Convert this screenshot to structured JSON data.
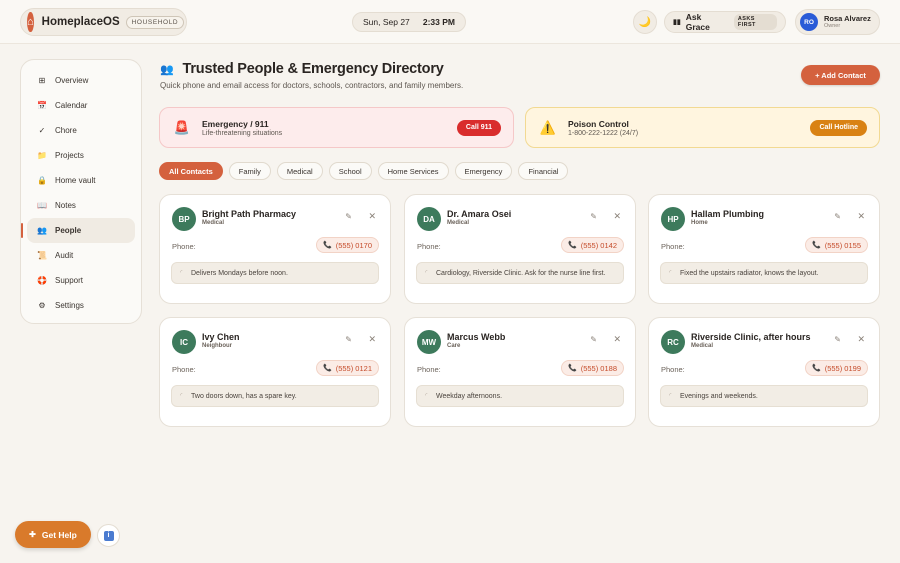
{
  "app": {
    "name": "HomeplaceOS",
    "household_tag": "HOUSEHOLD"
  },
  "topbar": {
    "date": "Sun, Sep 27",
    "time": "2:33 PM",
    "theme_icon": "moon-icon",
    "ask_label": "Ask Grace",
    "ask_tag": "ASKS FIRST",
    "user": {
      "initials": "RO",
      "name": "Rosa Alvarez",
      "role": "Owner"
    }
  },
  "sidebar": {
    "items": [
      {
        "label": "Overview",
        "icon": "grid-icon"
      },
      {
        "label": "Calendar",
        "icon": "calendar-icon"
      },
      {
        "label": "Chore",
        "icon": "check-icon"
      },
      {
        "label": "Projects",
        "icon": "folder-icon"
      },
      {
        "label": "Home vault",
        "icon": "lock-icon"
      },
      {
        "label": "Notes",
        "icon": "book-icon"
      },
      {
        "label": "People",
        "icon": "people-icon",
        "active": true
      },
      {
        "label": "Audit",
        "icon": "scroll-icon"
      },
      {
        "label": "Support",
        "icon": "lifebuoy-icon"
      },
      {
        "label": "Settings",
        "icon": "gear-icon"
      }
    ]
  },
  "header": {
    "title": "Trusted People & Emergency Directory",
    "subtitle": "Quick phone and email access for doctors, schools, contractors, and family members.",
    "add_label": "+ Add Contact"
  },
  "alerts": [
    {
      "title": "Emergency / 911",
      "subtitle": "Life-threatening situations",
      "button": "Call 911",
      "color": "#d92d2d"
    },
    {
      "title": "Poison Control",
      "subtitle": "1-800-222-1222 (24/7)",
      "button": "Call Hotline",
      "color": "#d98214"
    }
  ],
  "filters": [
    "All Contacts",
    "Family",
    "Medical",
    "School",
    "Home Services",
    "Emergency",
    "Financial"
  ],
  "active_filter": "All Contacts",
  "phone_label": "Phone:",
  "contacts": [
    {
      "initials": "BP",
      "name": "Bright Path Pharmacy",
      "role": "Medical",
      "phone": "(555) 0170",
      "note": "Delivers Mondays before noon."
    },
    {
      "initials": "DA",
      "name": "Dr. Amara Osei",
      "role": "Medical",
      "phone": "(555) 0142",
      "note": "Cardiology, Riverside Clinic. Ask for the nurse line first."
    },
    {
      "initials": "HP",
      "name": "Hallam Plumbing",
      "role": "Home",
      "phone": "(555) 0155",
      "note": "Fixed the upstairs radiator, knows the layout."
    },
    {
      "initials": "IC",
      "name": "Ivy Chen",
      "role": "Neighbour",
      "phone": "(555) 0121",
      "note": "Two doors down, has a spare key."
    },
    {
      "initials": "MW",
      "name": "Marcus Webb",
      "role": "Care",
      "phone": "(555) 0188",
      "note": "Weekday afternoons."
    },
    {
      "initials": "RC",
      "name": "Riverside Clinic, after hours",
      "role": "Medical",
      "phone": "(555) 0199",
      "note": "Evenings and weekends."
    }
  ],
  "help": {
    "label": "Get Help",
    "info_icon": "info-icon"
  },
  "colors": {
    "accent": "#d4613e",
    "avatar_green": "#3d7a5c",
    "help_orange": "#d97a2b"
  }
}
